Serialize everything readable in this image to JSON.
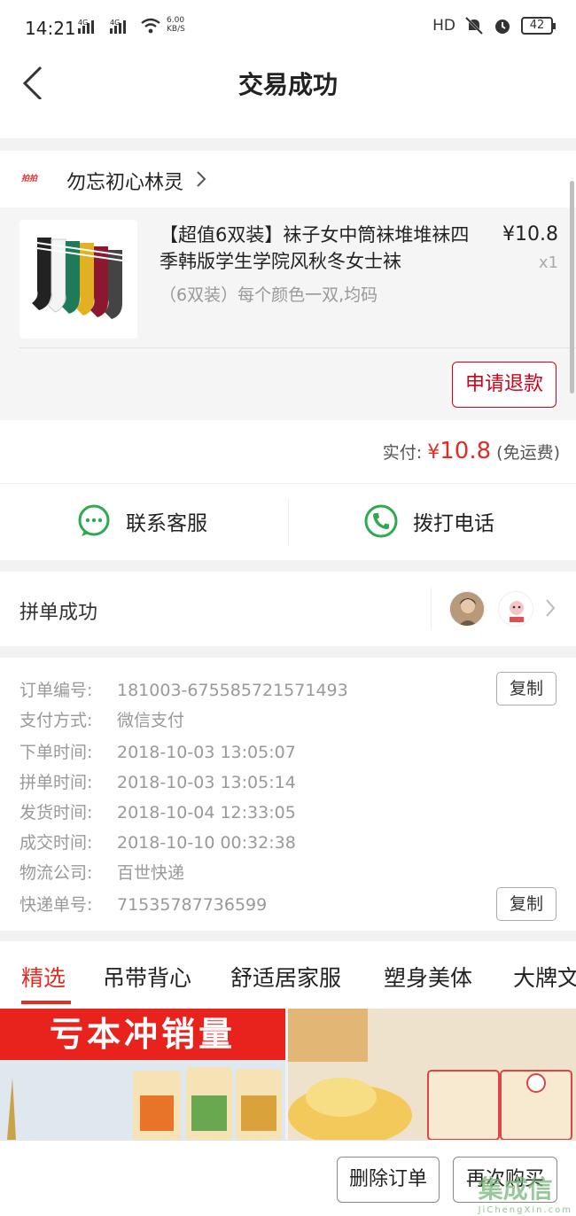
{
  "status": {
    "time": "14:21",
    "net_left": "4G",
    "net_right": "4G",
    "speed_value": "6.00",
    "speed_unit": "KB/S",
    "hd": "HD",
    "battery": "42"
  },
  "nav": {
    "title": "交易成功"
  },
  "shop": {
    "name": "勿忘初心林灵",
    "logo_text": "拍拍"
  },
  "product": {
    "title": "【超值6双装】袜子女中筒袜堆堆袜四季韩版学生学院风秋冬女士袜",
    "sku": "（6双装）每个颜色一双,均码",
    "price": "¥10.8",
    "qty": "x1",
    "refund_label": "申请退款"
  },
  "payment": {
    "label": "实付:",
    "currency": "¥",
    "amount": "10.8",
    "note": "(免运费)"
  },
  "contact": {
    "service_label": "联系客服",
    "phone_label": "拨打电话",
    "accent": "#2fa84f"
  },
  "group": {
    "label": "拼单成功"
  },
  "order_info": {
    "rows": [
      {
        "key": "订单编号:",
        "value": "181003-675585721571493"
      },
      {
        "key": "支付方式:",
        "value": "微信支付"
      },
      {
        "key": "下单时间:",
        "value": "2018-10-03 13:05:07"
      },
      {
        "key": "拼单时间:",
        "value": "2018-10-03 13:05:14"
      },
      {
        "key": "发货时间:",
        "value": "2018-10-04 12:33:05"
      },
      {
        "key": "成交时间:",
        "value": "2018-10-10 00:32:38"
      },
      {
        "key": "物流公司:",
        "value": "百世快递"
      },
      {
        "key": "快递单号:",
        "value": "71535787736599"
      }
    ],
    "copy_label": "复制"
  },
  "tabs": [
    "精选",
    "吊带背心",
    "舒适居家服",
    "塑身美体",
    "大牌文"
  ],
  "banner": {
    "left_text": "亏本冲销量"
  },
  "actions": {
    "delete_label": "删除订单",
    "rebuy_label": "再次购买"
  },
  "watermark": {
    "main": "集成信",
    "sub": "JiChengXin.com"
  },
  "colors": {
    "accent_red": "#e02e24",
    "refund_red": "#d0021b"
  }
}
